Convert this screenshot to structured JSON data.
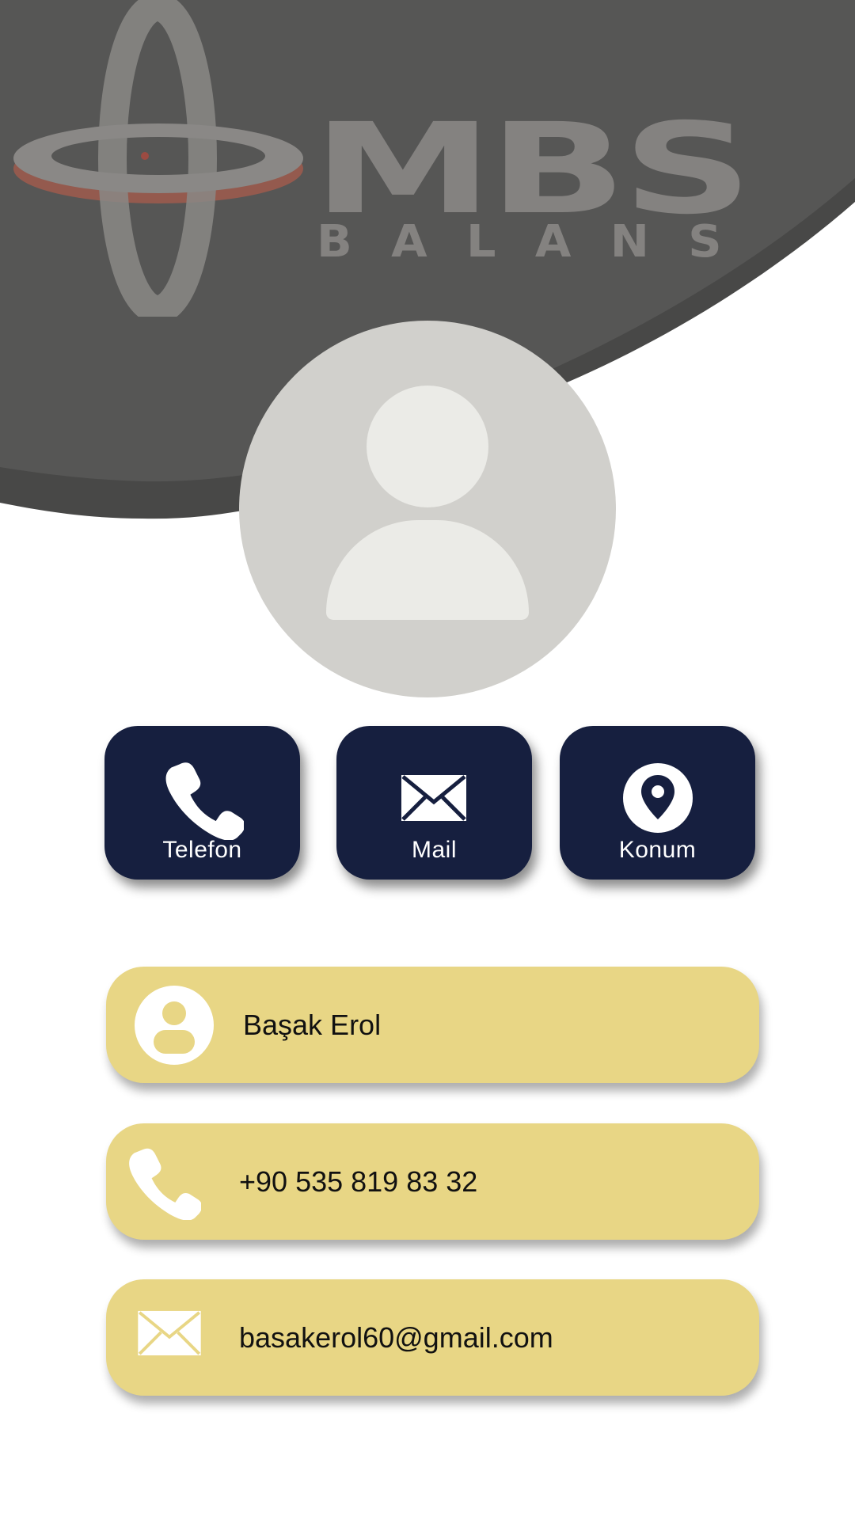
{
  "brand": {
    "title": "MBS",
    "subtitle": "BALANS"
  },
  "colors": {
    "header_bg": "#565655",
    "header_shadow": "#484847",
    "button_bg": "#161f3f",
    "card_bg": "#e8d685",
    "avatar_bg": "#d1d0cc",
    "logo_accent": "#b1614f"
  },
  "actions": [
    {
      "label": "Telefon",
      "icon": "phone-icon"
    },
    {
      "label": "Mail",
      "icon": "mail-icon"
    },
    {
      "label": "Konum",
      "icon": "location-pin-icon"
    }
  ],
  "contact": {
    "name": "Başak Erol",
    "phone": "+90 535 819 83 32",
    "email": "basakerol60@gmail.com",
    "name_icon": "person-icon",
    "phone_icon": "phone-icon",
    "email_icon": "mail-icon"
  }
}
